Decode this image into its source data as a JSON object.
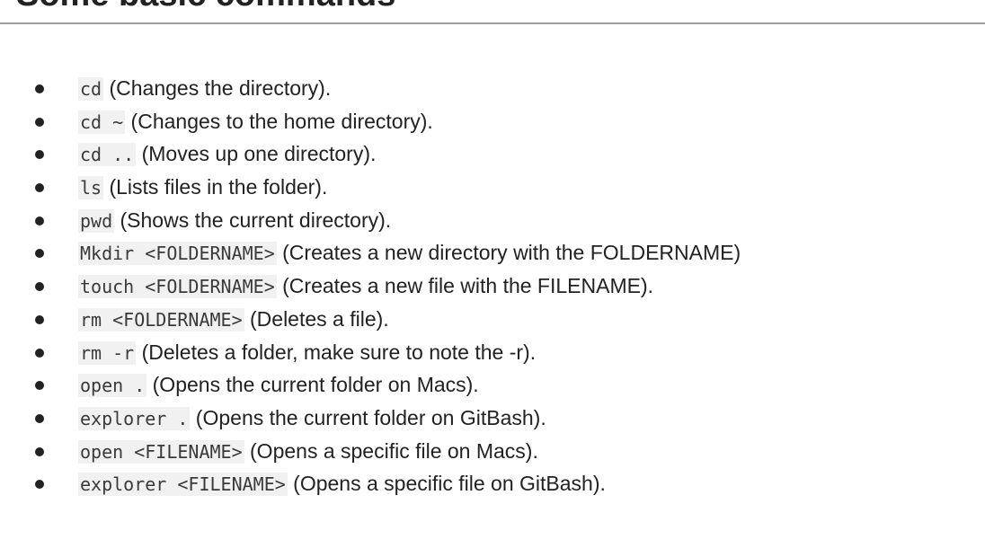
{
  "slide": {
    "title": "Some basic commands"
  },
  "commands": [
    {
      "cmd": "cd",
      "desc": " (Changes the directory)."
    },
    {
      "cmd": "cd ~",
      "desc": " (Changes to the home directory)."
    },
    {
      "cmd": "cd ..",
      "desc": " (Moves up one directory)."
    },
    {
      "cmd": "ls",
      "desc": " (Lists files in the folder)."
    },
    {
      "cmd": "pwd",
      "desc": " (Shows the current directory)."
    },
    {
      "cmd": "Mkdir <FOLDERNAME>",
      "desc": "  (Creates a new directory with the FOLDERNAME)"
    },
    {
      "cmd": "touch <FOLDERNAME>",
      "desc": " (Creates a new file with the FILENAME)."
    },
    {
      "cmd": "rm <FOLDERNAME>",
      "desc": " (Deletes a file)."
    },
    {
      "cmd": "rm -r",
      "desc": " (Deletes a folder, make sure to note the -r)."
    },
    {
      "cmd": "open .",
      "desc": " (Opens the current folder on Macs)."
    },
    {
      "cmd": "explorer .",
      "desc": " (Opens the current folder on GitBash)."
    },
    {
      "cmd": "open <FILENAME>",
      "desc": " (Opens a specific file on Macs)."
    },
    {
      "cmd": "explorer <FILENAME>",
      "desc": " (Opens a specific file on GitBash)."
    }
  ]
}
